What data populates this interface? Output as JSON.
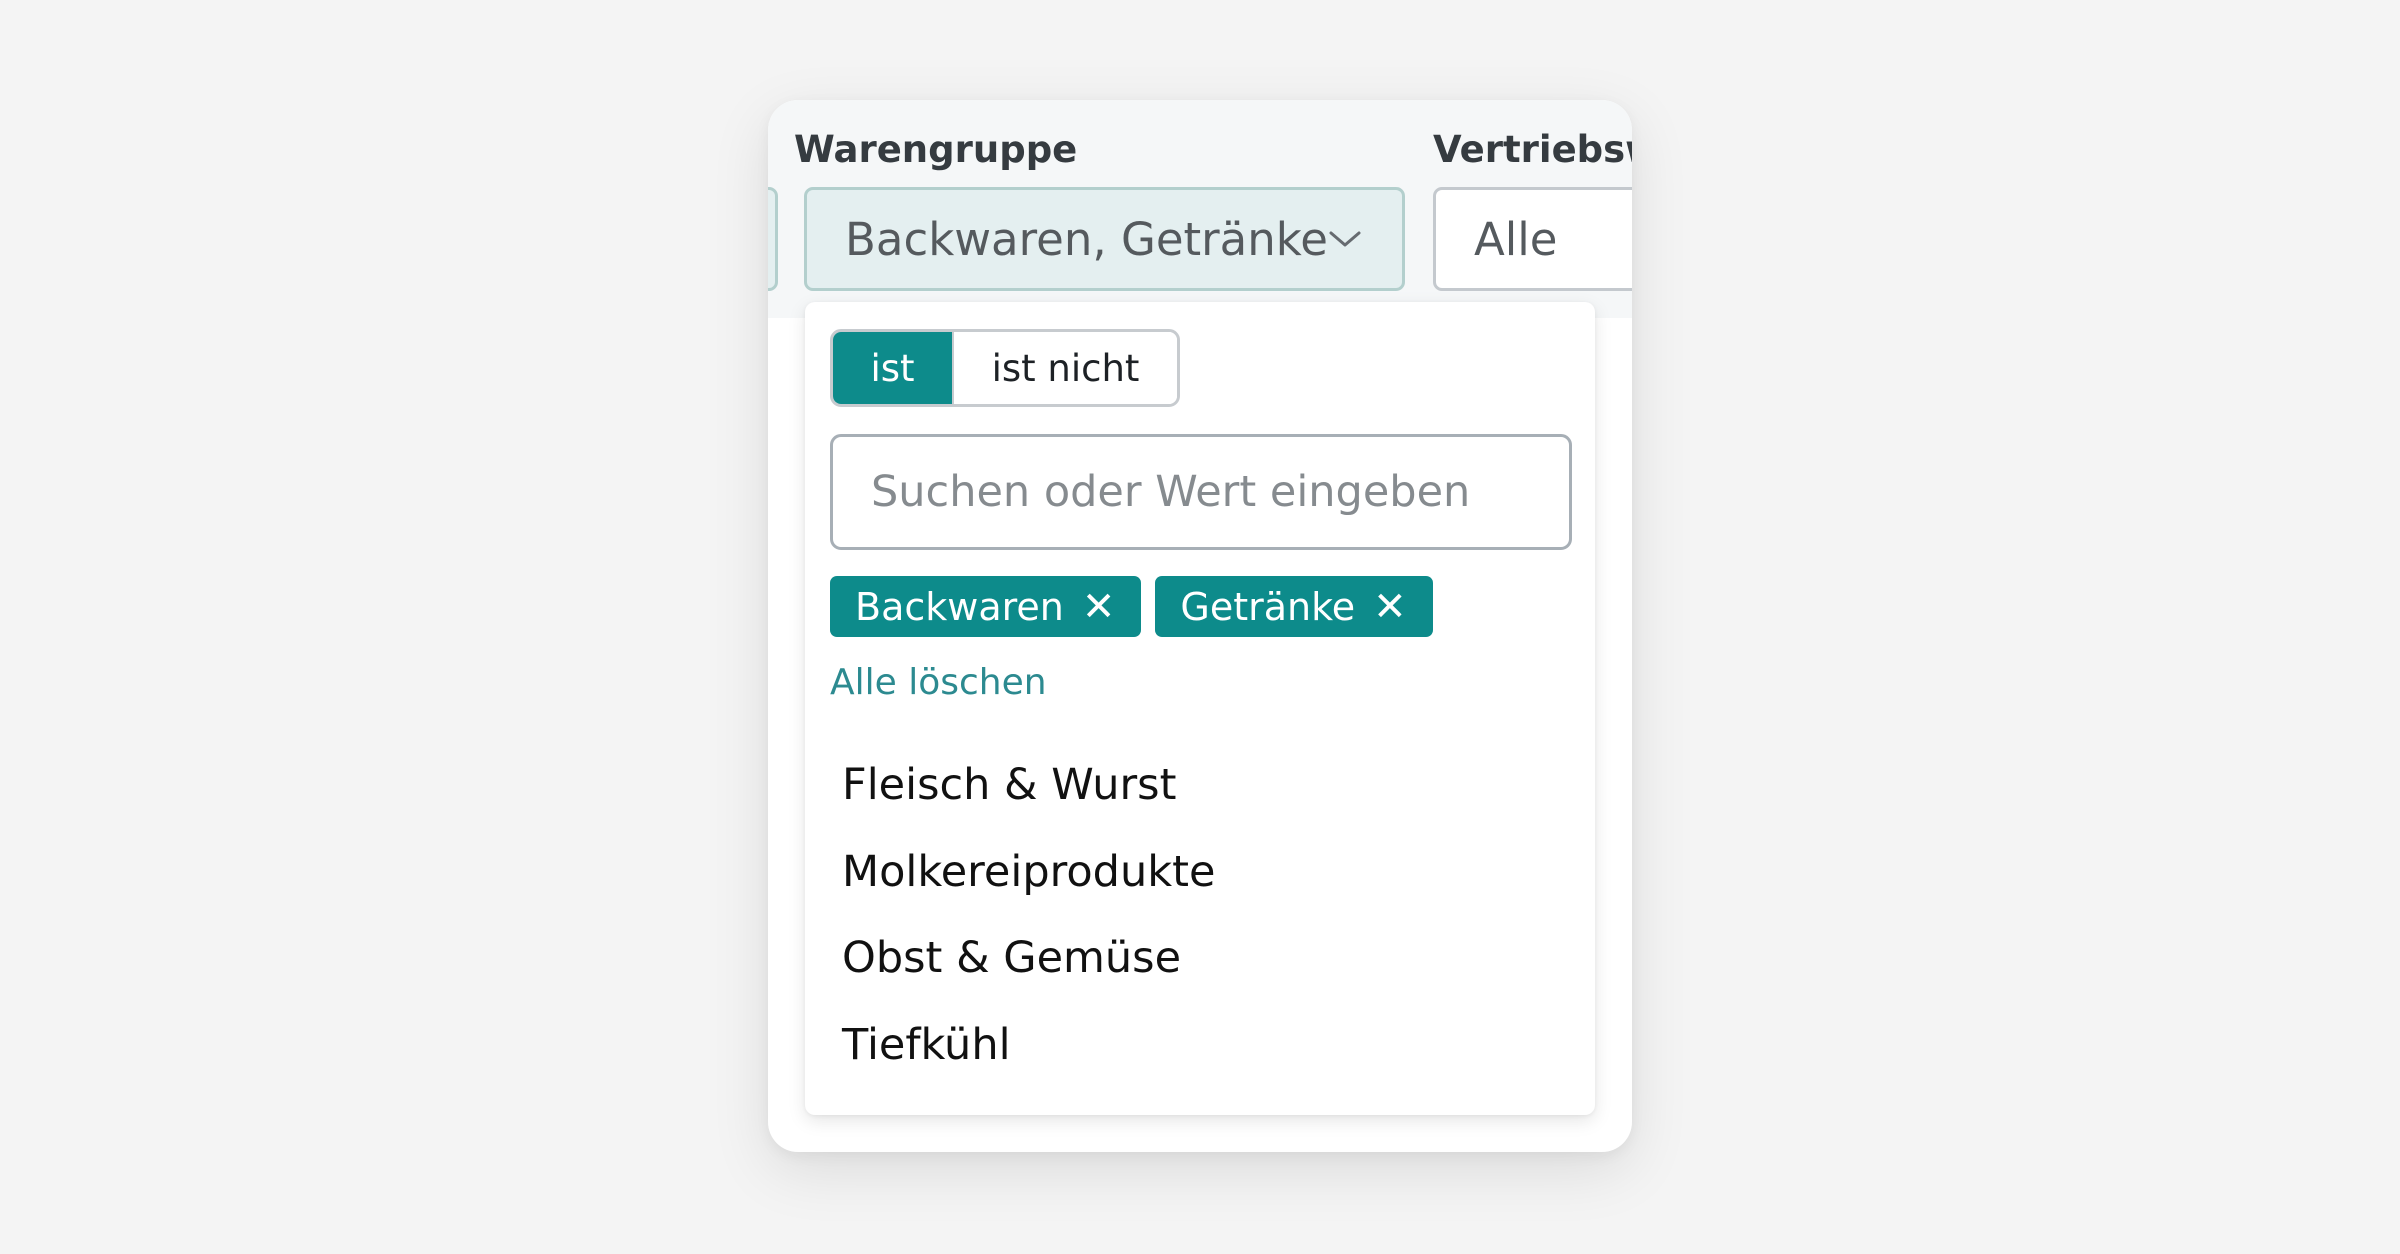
{
  "filters": {
    "warengruppe": {
      "label": "Warengruppe",
      "value": "Backwaren, Getränke"
    },
    "vertriebsweg": {
      "label": "Vertriebsw",
      "value": "Alle"
    }
  },
  "dropdown": {
    "mode": {
      "is_label": "ist",
      "is_not_label": "ist nicht",
      "selected": "ist"
    },
    "search": {
      "placeholder": "Suchen oder Wert eingeben",
      "value": ""
    },
    "selected_chips": [
      {
        "label": "Backwaren",
        "remove": "✕"
      },
      {
        "label": "Getränke",
        "remove": "✕"
      }
    ],
    "clear_all_label": "Alle löschen",
    "options": [
      {
        "label": "Fleisch & Wurst"
      },
      {
        "label": "Molkereiprodukte"
      },
      {
        "label": "Obst & Gemüse"
      },
      {
        "label": "Tiefkühl"
      }
    ]
  },
  "colors": {
    "accent": "#0d8b8b",
    "link": "#2c8a90",
    "active_field_bg": "#e4eff0",
    "active_field_border": "#b3cfcd"
  },
  "icons": {
    "dropdown_indicator": "chevron-down-icon",
    "chip_remove": "close-icon"
  }
}
